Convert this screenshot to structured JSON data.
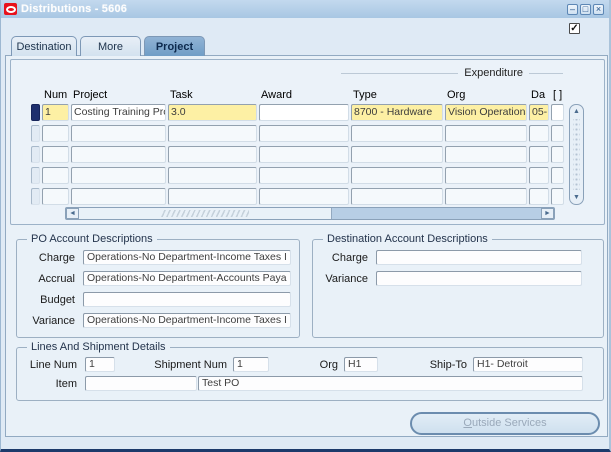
{
  "window": {
    "title": "Distributions - 5606",
    "controls": {
      "minimize": "–",
      "maximize": "□",
      "close": "×"
    },
    "header_checkbox_checked": true
  },
  "icons": {
    "check": "✓",
    "scroll_up": "▲",
    "scroll_down": "▼",
    "scroll_left": "◄",
    "scroll_right": "►"
  },
  "colors": {
    "titlebar": "#aecce8",
    "active_tab": "#7aa3c9",
    "required_field_yellow": "#fdf0a4",
    "record_selector_navy": "#1e2f6e",
    "window_bottom_border": "#1c3a6b"
  },
  "tabs": [
    {
      "label": "Destination",
      "active": false
    },
    {
      "label": "More",
      "active": false
    },
    {
      "label": "Project",
      "active": true
    }
  ],
  "grid": {
    "group_label": "Expenditure",
    "columns": [
      "Num",
      "Project",
      "Task",
      "Award",
      "Type",
      "Org",
      "Da",
      "[ ]"
    ],
    "rows": [
      {
        "num": "1",
        "project": "Costing Training Proje",
        "task": "3.0",
        "award": "",
        "type": "8700 - Hardware",
        "org": "Vision Operations",
        "date": "05-"
      }
    ],
    "empty_row_count": 4
  },
  "po_account": {
    "title": "PO Account Descriptions",
    "fields": [
      {
        "label": "Charge",
        "value": "Operations-No Department-Income Taxes I"
      },
      {
        "label": "Accrual",
        "value": "Operations-No Department-Accounts Paya"
      },
      {
        "label": "Budget",
        "value": ""
      },
      {
        "label": "Variance",
        "value": "Operations-No Department-Income Taxes I"
      }
    ]
  },
  "destination_account": {
    "title": "Destination Account Descriptions",
    "fields": [
      {
        "label": "Charge",
        "value": ""
      },
      {
        "label": "Variance",
        "value": ""
      }
    ]
  },
  "lines_shipment": {
    "title": "Lines And Shipment Details",
    "line_num": {
      "label": "Line Num",
      "value": "1"
    },
    "shipment_num": {
      "label": "Shipment Num",
      "value": "1"
    },
    "org": {
      "label": "Org",
      "value": "H1"
    },
    "ship_to": {
      "label": "Ship-To",
      "value": "H1- Detroit"
    },
    "item": {
      "label": "Item",
      "value": ""
    },
    "description": "Test PO"
  },
  "footer": {
    "outside_services_label": "Outside Services"
  }
}
